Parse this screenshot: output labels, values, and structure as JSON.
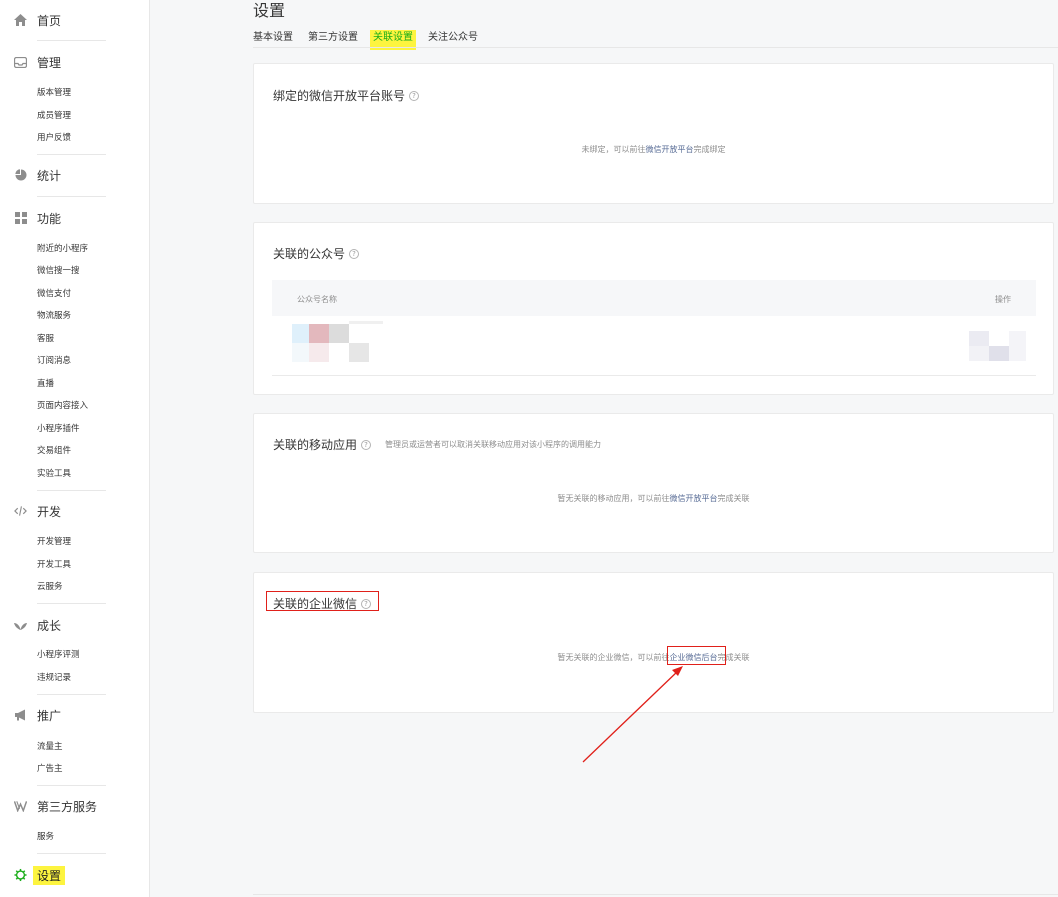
{
  "sidebar": {
    "home": {
      "label": "首页",
      "icon": "home-icon"
    },
    "manage": {
      "label": "管理",
      "icon": "inbox-icon",
      "items": [
        "版本管理",
        "成员管理",
        "用户反馈"
      ]
    },
    "stats": {
      "label": "统计",
      "icon": "pie-chart-icon"
    },
    "features": {
      "label": "功能",
      "icon": "grid-icon",
      "items": [
        "附近的小程序",
        "微信搜一搜",
        "微信支付",
        "物流服务",
        "客服",
        "订阅消息",
        "直播",
        "页面内容接入",
        "小程序插件",
        "交易组件",
        "实验工具"
      ]
    },
    "dev": {
      "label": "开发",
      "icon": "code-icon",
      "items": [
        "开发管理",
        "开发工具",
        "云服务"
      ]
    },
    "growth": {
      "label": "成长",
      "icon": "sprout-icon",
      "items": [
        "小程序评测",
        "违规记录"
      ]
    },
    "promo": {
      "label": "推广",
      "icon": "megaphone-icon",
      "items": [
        "流量主",
        "广告主"
      ]
    },
    "thirdparty": {
      "label": "第三方服务",
      "icon": "third-party-icon",
      "items": [
        "服务"
      ]
    },
    "settings": {
      "label": "设置",
      "icon": "gear-icon"
    }
  },
  "page": {
    "title": "设置",
    "tabs": [
      {
        "label": "基本设置",
        "active": false
      },
      {
        "label": "第三方设置",
        "active": false
      },
      {
        "label": "关联设置",
        "active": true
      },
      {
        "label": "关注公众号",
        "active": false
      }
    ]
  },
  "cards": {
    "open_platform": {
      "title": "绑定的微信开放平台账号",
      "empty_prefix": "未绑定，可以前往",
      "empty_link": "微信开放平台",
      "empty_suffix": "完成绑定"
    },
    "official_accounts": {
      "title": "关联的公众号",
      "col_name": "公众号名称",
      "col_action": "操作"
    },
    "mobile_apps": {
      "title": "关联的移动应用",
      "desc": "管理员或运营者可以取消关联移动应用对该小程序的调用能力",
      "empty_prefix": "暂无关联的移动应用，可以前往",
      "empty_link": "微信开放平台",
      "empty_suffix": "完成关联"
    },
    "work_wechat": {
      "title": "关联的企业微信",
      "empty_prefix": "暂无关联的企业微信，可以前往",
      "empty_link": "企业微信后台",
      "empty_suffix": "完成关联"
    }
  },
  "colors": {
    "highlight": "#fdf43f",
    "accent_green": "#1aad19",
    "link": "#576b95",
    "annotation_red": "#e0201a"
  }
}
